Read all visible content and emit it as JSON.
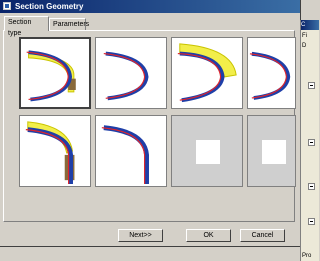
{
  "dialog": {
    "title": "Section Geometry",
    "tabs": [
      {
        "label": "Section type",
        "active": true
      },
      {
        "label": "Parameters",
        "active": false
      }
    ],
    "thumbnails": [
      {
        "name": "section-type-1",
        "selected": true
      },
      {
        "name": "section-type-2",
        "selected": false
      },
      {
        "name": "section-type-3",
        "selected": false
      },
      {
        "name": "section-type-4",
        "selected": false
      },
      {
        "name": "section-type-5",
        "selected": false
      },
      {
        "name": "section-type-6",
        "selected": false
      },
      {
        "name": "section-type-7-empty",
        "selected": false
      },
      {
        "name": "section-type-8-empty",
        "selected": false
      }
    ],
    "buttons": {
      "next": "Next>>",
      "ok": "OK",
      "cancel": "Cancel"
    }
  },
  "background_window": {
    "title": "C",
    "rows": [
      "Fi",
      "D"
    ],
    "footer": "Pro"
  },
  "colors": {
    "title_bar": "#0a246a",
    "arc_blue": "#1f3fa8",
    "arc_red": "#e0242b",
    "fill_yellow": "#f2ee4a",
    "fill_brown": "#8a6a3a"
  }
}
